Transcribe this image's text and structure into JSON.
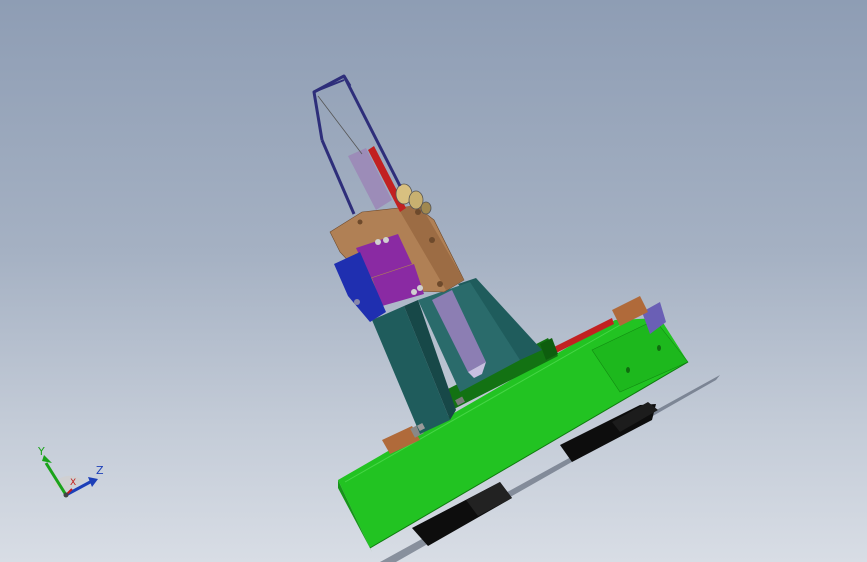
{
  "viewport": {
    "background_top": "#8e9db4",
    "background_bottom": "#d8dde5"
  },
  "model": {
    "base_color": "#1db81d",
    "column_color": "#1f5c5c",
    "carriage_color": "#b08055",
    "clamp_color": "#8a2aa3",
    "side_block_color": "#1f2fb0",
    "frame_color": "#2e2e7a",
    "wheel_color": "#0d0d0d"
  },
  "triad": {
    "y_label": "Y",
    "z_label": "Z",
    "x_label": "X",
    "y_color": "#1aa31a",
    "z_color": "#1c3fb8",
    "x_color": "#c21b1b"
  }
}
